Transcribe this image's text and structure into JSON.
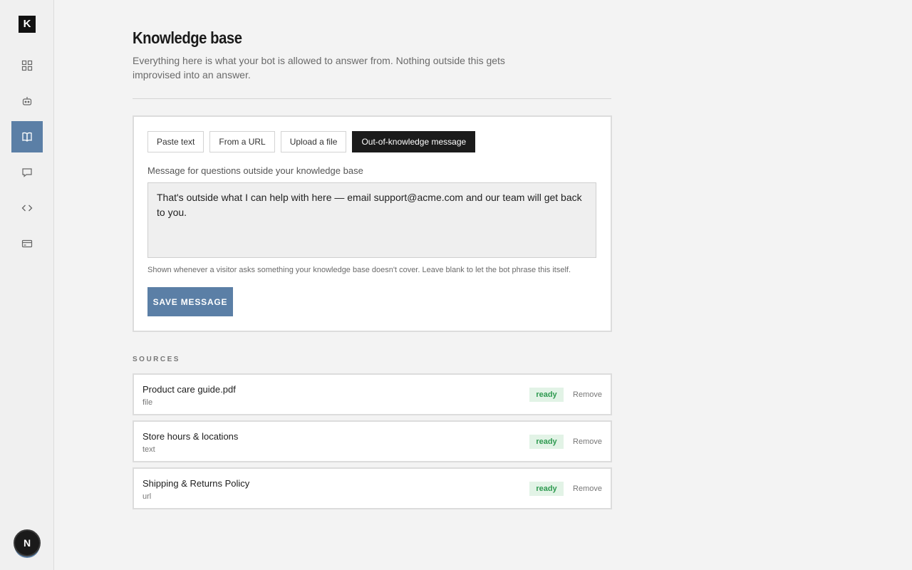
{
  "sidebar": {
    "logo": "K",
    "items": [
      {
        "name": "dashboard"
      },
      {
        "name": "bot"
      },
      {
        "name": "knowledge-base",
        "active": true
      },
      {
        "name": "conversations"
      },
      {
        "name": "embed-code"
      },
      {
        "name": "billing"
      }
    ],
    "avatar_initial": "N"
  },
  "page": {
    "title": "Knowledge base",
    "subtitle": "Everything here is what your bot is allowed to answer from. Nothing outside this gets improvised into an answer."
  },
  "tabs": [
    "Paste text",
    "From a URL",
    "Upload a file",
    "Out-of-knowledge message"
  ],
  "active_tab": "Out-of-knowledge message",
  "form": {
    "label": "Message for questions outside your knowledge base",
    "value": "That's outside what I can help with here — email support@acme.com and our team will get back to you.",
    "help": "Shown whenever a visitor asks something your knowledge base doesn't cover. Leave blank to let the bot phrase this itself.",
    "save_label": "SAVE MESSAGE"
  },
  "sources": {
    "heading": "SOURCES",
    "items": [
      {
        "name": "Product care guide.pdf",
        "type": "file",
        "status": "ready",
        "action": "Remove"
      },
      {
        "name": "Store hours & locations",
        "type": "text",
        "status": "ready",
        "action": "Remove"
      },
      {
        "name": "Shipping & Returns Policy",
        "type": "url",
        "status": "ready",
        "action": "Remove"
      }
    ]
  },
  "colors": {
    "accent": "#5b7fa6",
    "dark": "#1b1b1b",
    "ready_bg": "#e2f3e6",
    "ready_text": "#2e9a50"
  }
}
